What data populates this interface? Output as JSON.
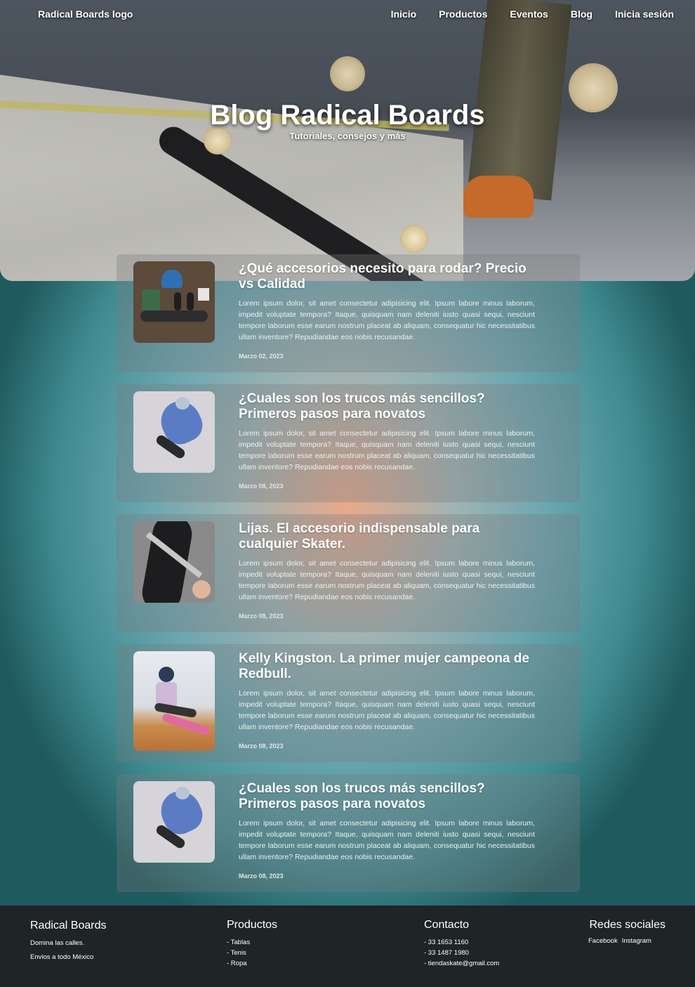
{
  "nav": {
    "logo": "Radical Boards logo",
    "items": [
      "Inicio",
      "Productos",
      "Eventos",
      "Blog",
      "Inicia sesión"
    ]
  },
  "hero": {
    "title": "Blog Radical Boards",
    "subtitle": "Tutoriales, consejos y más"
  },
  "posts": [
    {
      "title": "¿Qué accesorios necesito para rodar? Precio vs Calidad",
      "text": "Lorem ipsum dolor, sit amet consectetur adipisicing elit. Ipsum labore minus laborum, impedit voluptate tempora? Itaque, quisquam nam deleniti iusto quasi sequi, nesciunt tempore laborum esse earum nostrum placeat ab aliquam, consequatur hic necessitatibus ullam inventore? Repudiandae eos nobis recusandae.",
      "date": "Marzo 02, 2023"
    },
    {
      "title": "¿Cuales son los trucos más sencillos? Primeros pasos para novatos",
      "text": "Lorem ipsum dolor, sit amet consectetur adipisicing elit. Ipsum labore minus laborum, impedit voluptate tempora? Itaque, quisquam nam deleniti iusto quasi sequi, nesciunt tempore laborum esse earum nostrum placeat ab aliquam, consequatur hic necessitatibus ullam inventore? Repudiandae eos nobis recusandae.",
      "date": "Marzo 08, 2023"
    },
    {
      "title": "Lijas. El accesorio indispensable para cualquier Skater.",
      "text": "Lorem ipsum dolor, sit amet consectetur adipisicing elit. Ipsum labore minus laborum, impedit voluptate tempora? Itaque, quisquam nam deleniti iusto quasi sequi, nesciunt tempore laborum esse earum nostrum placeat ab aliquam, consequatur hic necessitatibus ullam inventore? Repudiandae eos nobis recusandae.",
      "date": "Marzo 08, 2023"
    },
    {
      "title": "Kelly Kingston. La primer mujer campeona de Redbull.",
      "text": "Lorem ipsum dolor, sit amet consectetur adipisicing elit. Ipsum labore minus laborum, impedit voluptate tempora? Itaque, quisquam nam deleniti iusto quasi sequi, nesciunt tempore laborum esse earum nostrum placeat ab aliquam, consequatur hic necessitatibus ullam inventore? Repudiandae eos nobis recusandae.",
      "date": "Marzo 08, 2023"
    },
    {
      "title": "¿Cuales son los trucos más sencillos? Primeros pasos para novatos",
      "text": "Lorem ipsum dolor, sit amet consectetur adipisicing elit. Ipsum labore minus laborum, impedit voluptate tempora? Itaque, quisquam nam deleniti iusto quasi sequi, nesciunt tempore laborum esse earum nostrum placeat ab aliquam, consequatur hic necessitatibus ullam inventore? Repudiandae eos nobis recusandae.",
      "date": "Marzo 08, 2023"
    }
  ],
  "footer": {
    "brand": {
      "title": "Radical Boards",
      "lines": [
        "Domina las calles.",
        "Envios a todo México"
      ]
    },
    "products": {
      "title": "Productos",
      "items": [
        "- Tablas",
        "- Tenis",
        "- Ropa"
      ]
    },
    "contact": {
      "title": "Contacto",
      "items": [
        "- 33 1653 1160",
        "- 33 1487 1980",
        "- tiendaskate@gmail.com"
      ]
    },
    "social": {
      "title": "Redes sociales",
      "items": [
        "Facebook",
        "Instagram"
      ]
    }
  }
}
